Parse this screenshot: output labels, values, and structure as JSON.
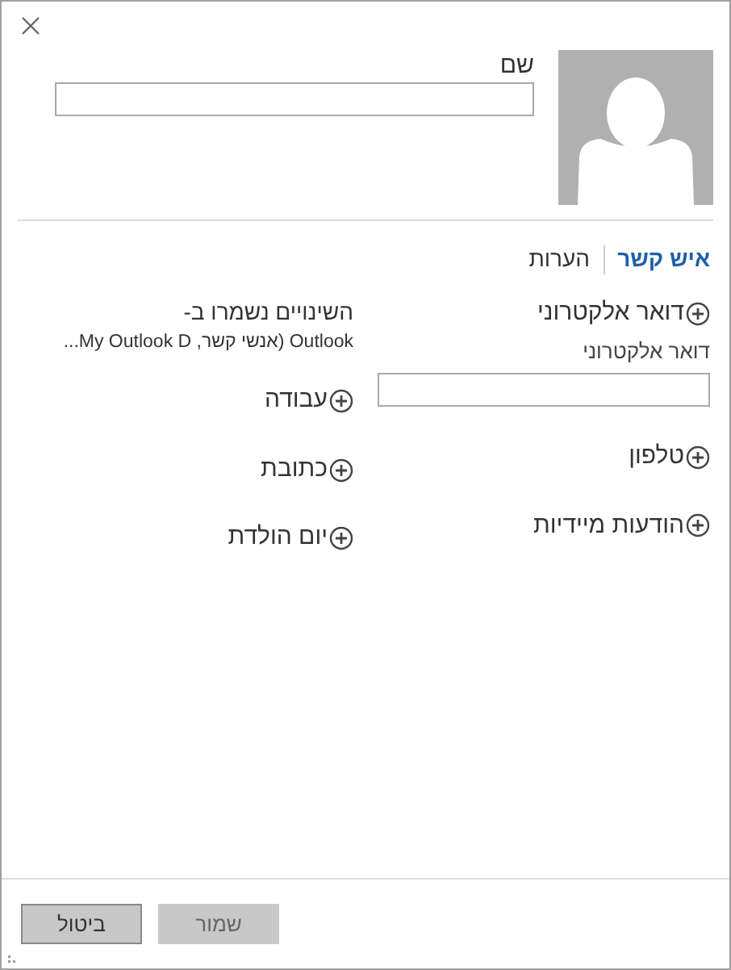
{
  "tabs": [
    {
      "label": "איש קשר",
      "selected": true
    },
    {
      "label": "הערות",
      "selected": false
    }
  ],
  "name_field": {
    "label": "שם"
  },
  "right_sections": [
    {
      "label": "דואר אלקטרוני",
      "field": {
        "label": "דואר אלקטרוני"
      }
    },
    {
      "label": "טלפון"
    },
    {
      "label": "הודעות מיידיות"
    }
  ],
  "save_info": {
    "title": "השינויים נשמרו ב-",
    "location": "Outlook (אנשי קשר, My Outlook D..."
  },
  "left_sections": [
    {
      "label": "עבודה"
    },
    {
      "label": "כתובת"
    },
    {
      "label": "יום הולדת"
    }
  ],
  "buttons": [
    {
      "label": "שמור",
      "disabled": true
    },
    {
      "label": "ביטול",
      "disabled": false
    }
  ]
}
